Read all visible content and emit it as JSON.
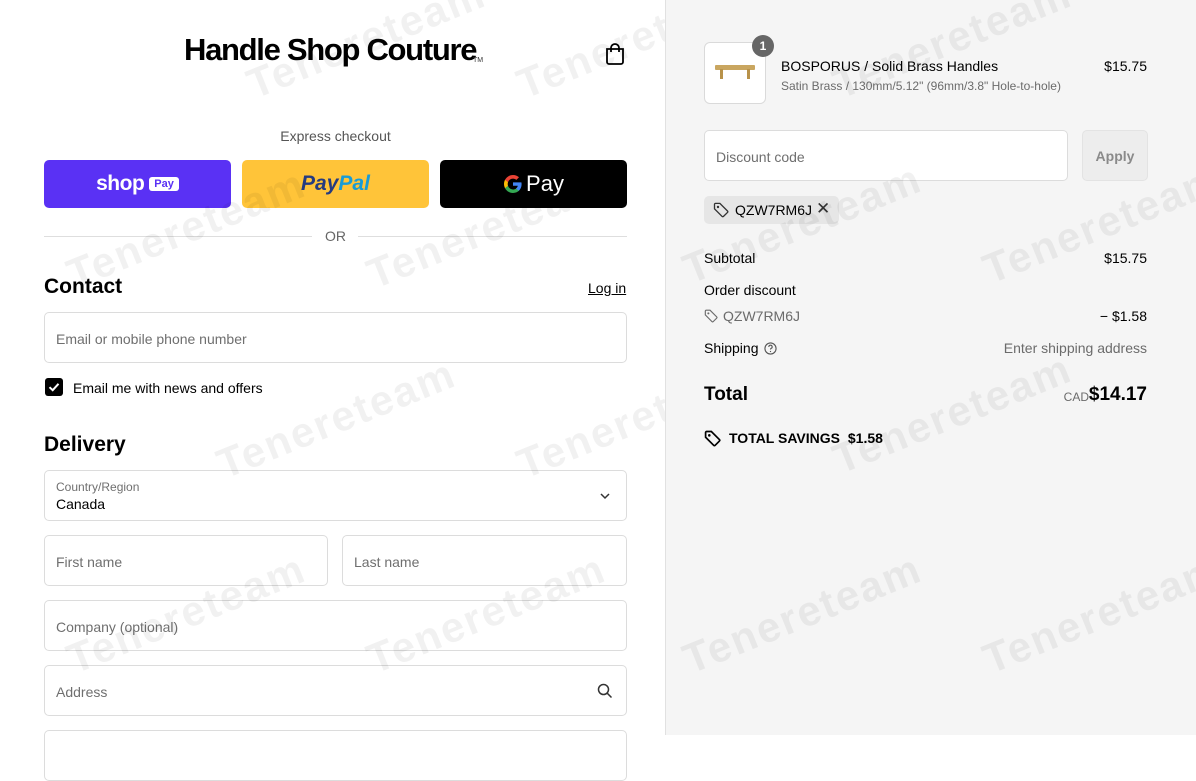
{
  "header": {
    "logo_text": "Handle Shop Couture",
    "logo_tm": "TM",
    "cart_icon": "shopping-bag-icon"
  },
  "express": {
    "label": "Express checkout",
    "shoppay": {
      "word": "shop",
      "pill": "Pay"
    },
    "paypal": {
      "part1": "Pay",
      "part2": "Pal"
    },
    "gpay": {
      "letter": "G",
      "word": "Pay"
    },
    "or_label": "OR"
  },
  "contact": {
    "heading": "Contact",
    "login_label": "Log in",
    "email_placeholder": "Email or mobile phone number",
    "newsletter_label": "Email me with news and offers",
    "newsletter_checked": true
  },
  "delivery": {
    "heading": "Delivery",
    "country_label": "Country/Region",
    "country_value": "Canada",
    "first_name_placeholder": "First name",
    "last_name_placeholder": "Last name",
    "company_placeholder": "Company (optional)",
    "address_placeholder": "Address"
  },
  "summary": {
    "item": {
      "quantity": "1",
      "name": "BOSPORUS / Solid Brass Handles",
      "variant": "Satin Brass / 130mm/5.12\" (96mm/3.8\" Hole-to-hole)",
      "price": "$15.75"
    },
    "discount_placeholder": "Discount code",
    "apply_label": "Apply",
    "applied_code": "QZW7RM6J",
    "subtotal_label": "Subtotal",
    "subtotal_value": "$15.75",
    "order_discount_label": "Order discount",
    "discount_code": "QZW7RM6J",
    "discount_value": "− $1.58",
    "shipping_label": "Shipping",
    "shipping_value": "Enter shipping address",
    "total_label": "Total",
    "currency": "CAD",
    "total_value": "$14.17",
    "savings_label": "TOTAL SAVINGS",
    "savings_value": "$1.58"
  },
  "watermark": "Tenereteam",
  "colors": {
    "shoppay": "#5a31f4",
    "paypal": "#ffc439",
    "gpay": "#000000",
    "panel_bg": "#f5f5f5"
  }
}
